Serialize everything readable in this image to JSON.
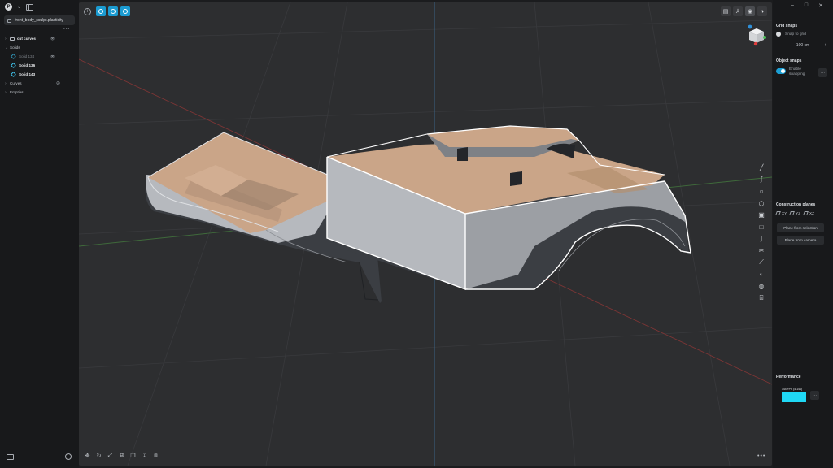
{
  "left_panel": {
    "logo_letter": "P",
    "file_tab": "front_body_sculpt.plasticity",
    "outliner": {
      "group": "cut curves",
      "solids_label": "Solids",
      "solids": [
        {
          "name": "Solid 134",
          "state": "dim"
        },
        {
          "name": "Solid 136",
          "state": "bold"
        },
        {
          "name": "Solid 143",
          "state": "bold"
        }
      ],
      "curves_label": "Curves",
      "empties_label": "Empties"
    }
  },
  "viewport": {
    "colors": {
      "background": "#2d2e30",
      "grid": "#3b3c3e",
      "axis_red": "#8a3a3a",
      "axis_green": "#3d6b3a",
      "axis_blue": "#3d6a8d",
      "surface_top": "#c9a487",
      "surface_side": "#b4b7bc",
      "surface_dark": "#3b3e43",
      "selection": "#ffffff"
    },
    "right_tools": [
      "line-tool",
      "curve-tool",
      "circle-tool",
      "polygon-tool",
      "box-tool",
      "rectangle-tool",
      "spiral-tool",
      "trim-tool",
      "cut-tool",
      "shell-tool",
      "sphere-tool",
      "cylinder-tool"
    ],
    "bottom_tools": [
      "move-tool",
      "rotate-tool",
      "scale-tool",
      "boolean-tool",
      "duplicate-tool",
      "mirror-tool",
      "array-tool"
    ],
    "more_label": "•••"
  },
  "right_panel": {
    "grid_snaps": {
      "title": "Grid snaps",
      "snap_label": "Snap to grid",
      "minus": "−",
      "value": "100 cm",
      "plus": "+"
    },
    "object_snaps": {
      "title": "Object snaps",
      "enable_label": "Enable snapping",
      "more": "···"
    },
    "construction_planes": {
      "title": "Construction planes",
      "planes": [
        "XY",
        "YZ",
        "XZ"
      ],
      "from_selection": "Plane from selection",
      "from_camera": "Plane from camera"
    },
    "performance": {
      "title": "Performance",
      "fps_text": "144 FPS (4-144)",
      "bar_color": "#1fd8f5",
      "more": "···"
    }
  }
}
